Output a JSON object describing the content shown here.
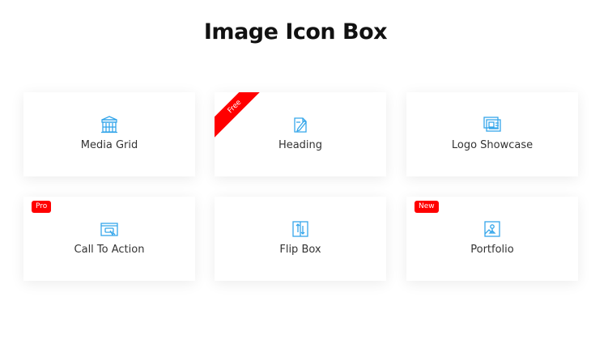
{
  "page": {
    "title": "Image Icon Box"
  },
  "colors": {
    "accent_icon": "#35a6ea",
    "badge_red": "#ff0000",
    "text": "#333333",
    "title": "#111111"
  },
  "cards": [
    {
      "label": "Media Grid",
      "icon": "media-grid-icon"
    },
    {
      "label": "Heading",
      "icon": "heading-icon",
      "ribbon": "Free"
    },
    {
      "label": "Logo Showcase",
      "icon": "logo-showcase-icon"
    },
    {
      "label": "Call To Action",
      "icon": "call-to-action-icon",
      "badge": "Pro"
    },
    {
      "label": "Flip Box",
      "icon": "flip-box-icon"
    },
    {
      "label": "Portfolio",
      "icon": "portfolio-icon",
      "badge": "New"
    }
  ]
}
